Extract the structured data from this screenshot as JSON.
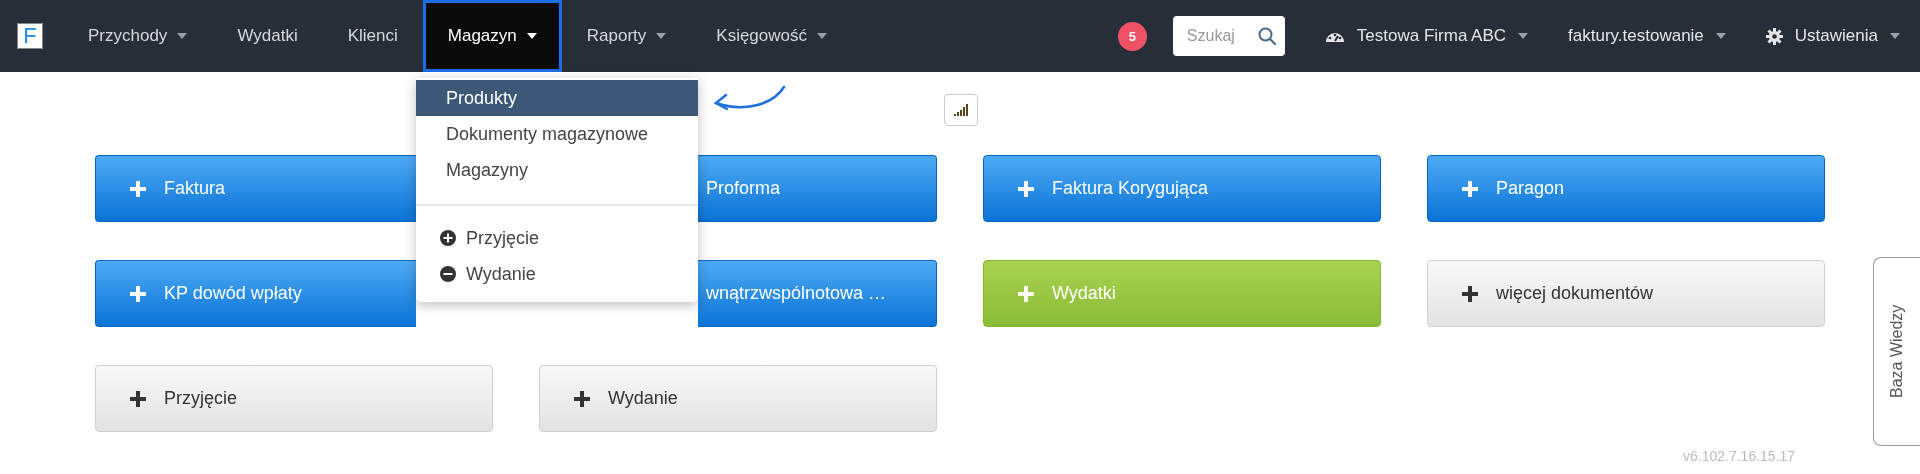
{
  "navbar": {
    "logo": "F",
    "menu": [
      {
        "label": "Przychody",
        "caret": true,
        "selected": false
      },
      {
        "label": "Wydatki",
        "caret": false,
        "selected": false
      },
      {
        "label": "Klienci",
        "caret": false,
        "selected": false
      },
      {
        "label": "Magazyn",
        "caret": true,
        "selected": true
      },
      {
        "label": "Raporty",
        "caret": true,
        "selected": false
      },
      {
        "label": "Księgowość",
        "caret": true,
        "selected": false
      }
    ],
    "notifications": "5",
    "search": {
      "placeholder": "Szukaj"
    },
    "right": [
      {
        "kind": "company",
        "label": "Testowa Firma ABC"
      },
      {
        "kind": "account",
        "label": "faktury.testowanie"
      },
      {
        "kind": "settings",
        "label": "Ustawienia"
      }
    ]
  },
  "dropdown": {
    "items": [
      {
        "label": "Produkty",
        "selected": true
      },
      {
        "label": "Dokumenty magazynowe",
        "selected": false
      },
      {
        "label": "Magazyny",
        "selected": false
      }
    ],
    "actions": [
      {
        "kind": "plus",
        "label": "Przyjęcie"
      },
      {
        "kind": "minus",
        "label": "Wydanie"
      }
    ]
  },
  "quick_buttons": [
    {
      "label": "Faktura",
      "kind": "primary",
      "covered_left": false,
      "covered_right": true
    },
    {
      "label": "Proforma",
      "kind": "primary",
      "covered_left": true,
      "covered_right": false
    },
    {
      "label": "Faktura Korygująca",
      "kind": "primary",
      "covered_left": false,
      "covered_right": false
    },
    {
      "label": "Paragon",
      "kind": "primary",
      "covered_left": false,
      "covered_right": false
    },
    {
      "label": "KP dowód wpłaty",
      "kind": "primary",
      "covered_left": false,
      "covered_right": true
    },
    {
      "label": "wnątrzwspólnotowa …",
      "kind": "primary",
      "covered_left": true,
      "covered_right": false
    },
    {
      "label": "Wydatki",
      "kind": "success",
      "covered_left": false,
      "covered_right": false
    },
    {
      "label": "więcej dokumentów",
      "kind": "default",
      "covered_left": false,
      "covered_right": false
    },
    {
      "label": "Przyjęcie",
      "kind": "default",
      "covered_left": false,
      "covered_right": false
    },
    {
      "label": "Wydanie",
      "kind": "default",
      "covered_left": false,
      "covered_right": false
    }
  ],
  "side_tab": {
    "label": "Baza Wiedzy"
  },
  "version": "v6.102.7.16.15.17"
}
